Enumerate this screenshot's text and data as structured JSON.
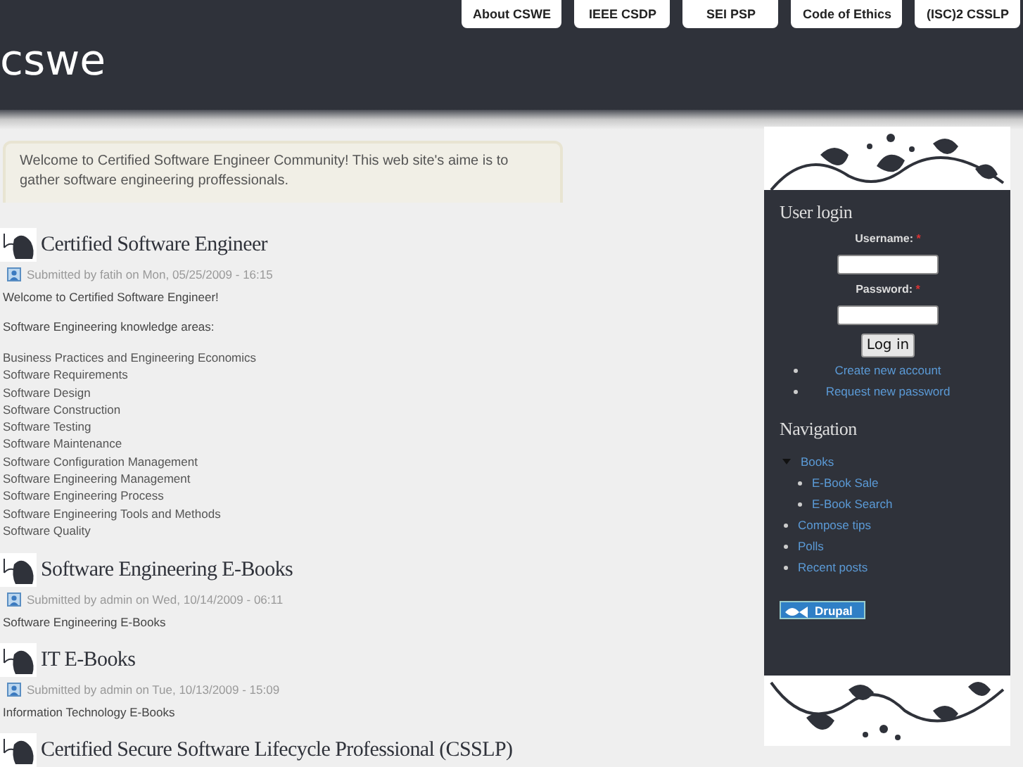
{
  "header": {
    "logo": "cswe",
    "nav": [
      "About CSWE",
      "IEEE CSDP",
      "SEI PSP",
      "Code of Ethics",
      "(ISC)2 CSSLP"
    ]
  },
  "mission": "Welcome to Certified Software Engineer Community! This web site's aime is to gather software engineering proffessionals.",
  "articles": [
    {
      "title": "Certified Software Engineer",
      "meta": "Submitted by fatih on Mon, 05/25/2009 - 16:15",
      "paragraphs": [
        "Welcome to Certified Software Engineer!",
        "Software Engineering knowledge areas:"
      ],
      "list": [
        "Business Practices and Engineering Economics",
        "Software Requirements",
        "Software Design",
        "Software Construction",
        "Software Testing",
        "Software Maintenance",
        "Software Configuration Management",
        "Software Engineering Management",
        "Software Engineering Process",
        "Software Engineering Tools and Methods",
        "Software Quality"
      ]
    },
    {
      "title": "Software Engineering E-Books",
      "meta": "Submitted by admin on Wed, 10/14/2009 - 06:11",
      "paragraphs": [
        "Software Engineering E-Books"
      ]
    },
    {
      "title": "IT E-Books",
      "meta": "Submitted by admin on Tue, 10/13/2009 - 15:09",
      "paragraphs": [
        "Information Technology E-Books"
      ]
    },
    {
      "title": "Certified Secure Software Lifecycle Professional (CSSLP)"
    }
  ],
  "login": {
    "title": "User login",
    "fields": [
      {
        "label": "Username:",
        "required_mark": "*"
      },
      {
        "label": "Password:",
        "required_mark": "*"
      }
    ],
    "button": "Log in",
    "links": [
      "Create new account",
      "Request new password"
    ]
  },
  "navigation": {
    "title": "Navigation",
    "items": [
      {
        "label": "Books",
        "expanded": true,
        "children": [
          {
            "label": "E-Book Sale"
          },
          {
            "label": "E-Book Search"
          }
        ]
      },
      {
        "label": "Compose tips"
      },
      {
        "label": "Polls"
      },
      {
        "label": "Recent posts"
      }
    ]
  },
  "badge": "Drupal"
}
